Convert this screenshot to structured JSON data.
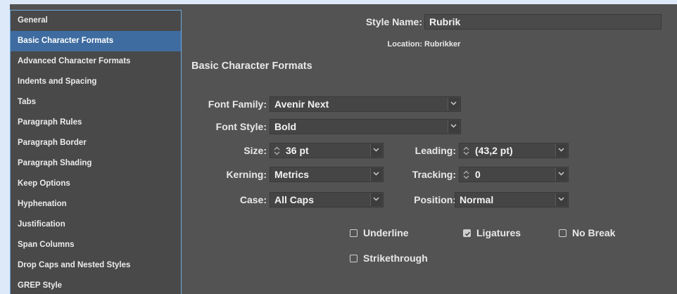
{
  "sidebar": {
    "items": [
      {
        "label": "General",
        "selected": false
      },
      {
        "label": "Basic Character Formats",
        "selected": true
      },
      {
        "label": "Advanced Character Formats",
        "selected": false
      },
      {
        "label": "Indents and Spacing",
        "selected": false
      },
      {
        "label": "Tabs",
        "selected": false
      },
      {
        "label": "Paragraph Rules",
        "selected": false
      },
      {
        "label": "Paragraph Border",
        "selected": false
      },
      {
        "label": "Paragraph Shading",
        "selected": false
      },
      {
        "label": "Keep Options",
        "selected": false
      },
      {
        "label": "Hyphenation",
        "selected": false
      },
      {
        "label": "Justification",
        "selected": false
      },
      {
        "label": "Span Columns",
        "selected": false
      },
      {
        "label": "Drop Caps and Nested Styles",
        "selected": false
      },
      {
        "label": "GREP Style",
        "selected": false
      }
    ]
  },
  "header": {
    "style_name_label": "Style Name:",
    "style_name_value": "Rubrik",
    "location_label": "Location:",
    "location_value": "Rubrikker"
  },
  "section_title": "Basic Character Formats",
  "form": {
    "font_family_label": "Font Family:",
    "font_family_value": "Avenir Next",
    "font_style_label": "Font Style:",
    "font_style_value": "Bold",
    "size_label": "Size:",
    "size_value": "36 pt",
    "leading_label": "Leading:",
    "leading_value": "(43,2 pt)",
    "kerning_label": "Kerning:",
    "kerning_value": "Metrics",
    "tracking_label": "Tracking:",
    "tracking_value": "0",
    "case_label": "Case:",
    "case_value": "All Caps",
    "position_label": "Position:",
    "position_value": "Normal"
  },
  "checkboxes": {
    "underline": {
      "label": "Underline",
      "checked": false
    },
    "ligatures": {
      "label": "Ligatures",
      "checked": true
    },
    "no_break": {
      "label": "No Break",
      "checked": false
    },
    "strikethrough": {
      "label": "Strikethrough",
      "checked": false
    }
  },
  "colors": {
    "panel_bg": "#535353",
    "sidebar_bg": "#494949",
    "selection": "#3f6ca0",
    "focus_border": "#6aa9dc",
    "page_bg": "#dde9f9"
  },
  "icons": [
    "spinner-icon",
    "chevron-down-icon",
    "checkmark-icon"
  ]
}
